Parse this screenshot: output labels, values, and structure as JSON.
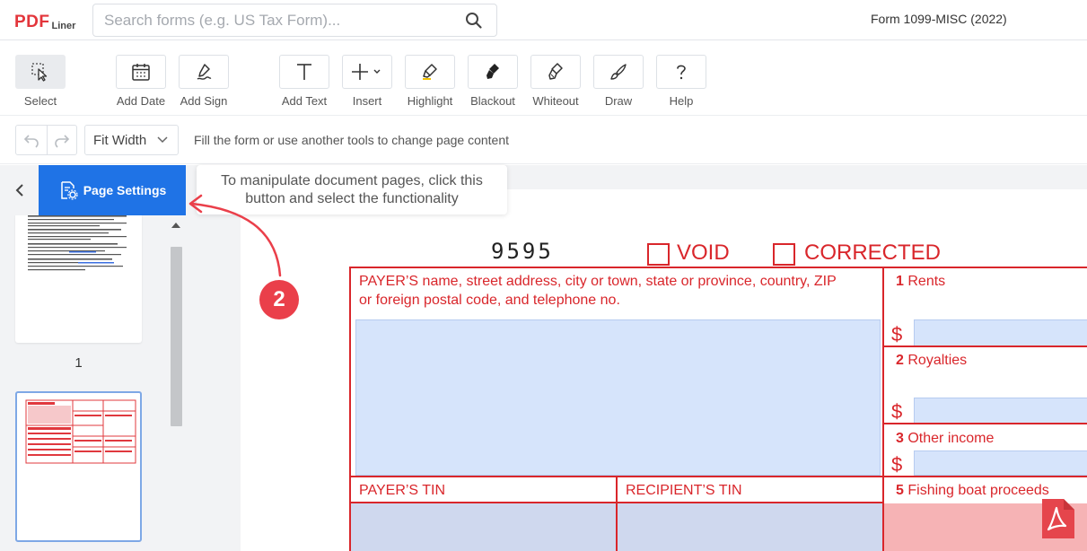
{
  "header": {
    "logo_main": "PDF",
    "logo_sub": "Liner",
    "search_placeholder": "Search forms (e.g. US Tax Form)...",
    "document_title": "Form 1099-MISC (2022)"
  },
  "toolbar": {
    "tools": [
      {
        "id": "select",
        "label": "Select",
        "icon": "cursor-select-icon",
        "active": true
      },
      {
        "id": "add-date",
        "label": "Add Date",
        "icon": "calendar-icon"
      },
      {
        "id": "add-sign",
        "label": "Add Sign",
        "icon": "signature-pen-icon"
      },
      {
        "id": "add-text",
        "label": "Add Text",
        "icon": "text-t-icon"
      },
      {
        "id": "insert",
        "label": "Insert",
        "icon": "plus-dropdown-icon"
      },
      {
        "id": "highlight",
        "label": "Highlight",
        "icon": "highlighter-icon"
      },
      {
        "id": "blackout",
        "label": "Blackout",
        "icon": "blackout-brush-icon"
      },
      {
        "id": "whiteout",
        "label": "Whiteout",
        "icon": "whiteout-brush-icon"
      },
      {
        "id": "draw",
        "label": "Draw",
        "icon": "brush-icon"
      },
      {
        "id": "help",
        "label": "Help",
        "icon": "question-mark-icon"
      }
    ]
  },
  "subbar": {
    "zoom_value": "Fit Width",
    "hint": "Fill the form or use another tools to change page content"
  },
  "sidebar": {
    "page_settings_label": "Page Settings",
    "pages": [
      {
        "number": "1"
      }
    ]
  },
  "tooltip": {
    "line1": "To manipulate document pages, click this",
    "line2": "button and select the functionality"
  },
  "annotation": {
    "step": "2"
  },
  "form": {
    "code": "9595",
    "void_label": "VOID",
    "corrected_label": "CORRECTED",
    "payer_name_label_1": "PAYER’S name, street address, city or town, state or province, country, ZIP",
    "payer_name_label_2": "or foreign postal code, and telephone no.",
    "box1_num": "1",
    "box1_label": "Rents",
    "box2_num": "2",
    "box2_label": "Royalties",
    "box3_num": "3",
    "box3_label": "Other income",
    "box5_num": "5",
    "box5_label": "Fishing boat proceeds",
    "payer_tin_label": "PAYER’S TIN",
    "recipient_tin_label": "RECIPIENT’S TIN",
    "currency_symbol": "$"
  },
  "colors": {
    "accent": "#1f73e6",
    "form_red": "#d9262b",
    "field_blue": "#d6e4fb",
    "badge": "#ea3f4a"
  }
}
